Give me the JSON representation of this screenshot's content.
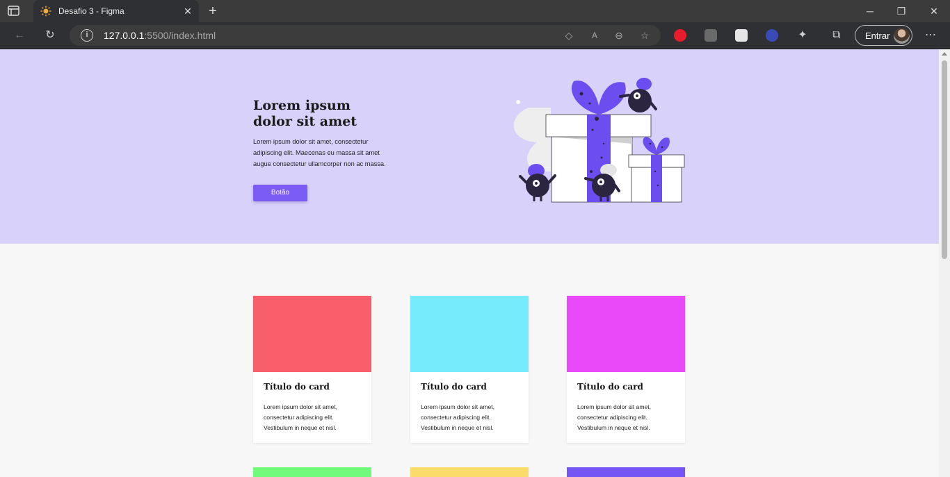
{
  "browser": {
    "tab_title": "Desafio 3 - Figma",
    "url_host": "127.0.0.1",
    "url_rest": ":5500/index.html",
    "signin_label": "Entrar"
  },
  "hero": {
    "title": "Lorem ipsum dolor sit amet",
    "text": "Lorem ipsum dolor sit amet, consectetur adipiscing elit. Maecenas eu massa sit amet augue consectetur ullamcorper non ac massa.",
    "button_label": "Botão"
  },
  "cards": [
    {
      "title": "Título do card",
      "text": "Lorem ipsum dolor sit amet, consectetur adipiscing elit. Vestibulum in neque et nisl.",
      "color": "#f85f6a"
    },
    {
      "title": "Título do card",
      "text": "Lorem ipsum dolor sit amet, consectetur adipiscing elit. Vestibulum in neque et nisl.",
      "color": "#76ebfb"
    },
    {
      "title": "Título do card",
      "text": "Lorem ipsum dolor sit amet, consectetur adipiscing elit. Vestibulum in neque et nisl.",
      "color": "#e949f8"
    }
  ],
  "next_row_colors": [
    "#72fa7a",
    "#fbdc6b",
    "#7655f5"
  ],
  "colors": {
    "hero_bg": "#d8d1fa",
    "accent": "#7b5cf5",
    "page_bg": "#f7f7f7"
  }
}
